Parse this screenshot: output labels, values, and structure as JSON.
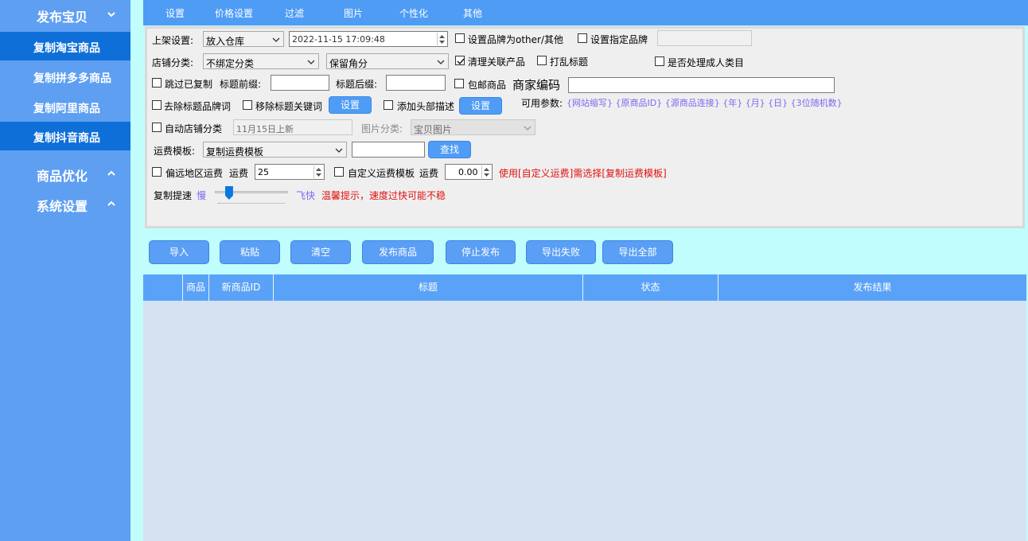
{
  "sidebar": {
    "sections": [
      {
        "label": "发布宝贝",
        "expanded": true
      },
      {
        "label": "商品优化",
        "expanded": false
      },
      {
        "label": "系统设置",
        "expanded": false
      }
    ],
    "items": [
      {
        "label": "复制淘宝商品"
      },
      {
        "label": "复制拼多多商品"
      },
      {
        "label": "复制阿里商品"
      },
      {
        "label": "复制抖音商品"
      }
    ]
  },
  "tabs": [
    "设置",
    "价格设置",
    "过滤",
    "图片",
    "个性化",
    "其他"
  ],
  "settings": {
    "shelf": {
      "label": "上架设置:",
      "option": "放入仓库",
      "datetime": "2022-11-15 17:09:48"
    },
    "brand_other": {
      "label": "设置品牌为other/其他",
      "checked": false
    },
    "brand_specific": {
      "label": "设置指定品牌",
      "checked": false,
      "value": ""
    },
    "shop_category": {
      "label": "店铺分类:",
      "option": "不绑定分类",
      "option2": "保留角分"
    },
    "clean_related": {
      "label": "清理关联产品",
      "checked": true
    },
    "shuffle_title": {
      "label": "打乱标题",
      "checked": false
    },
    "adult_category": {
      "label": "是否处理成人类目",
      "checked": false
    },
    "skip_copied": {
      "label": "跳过已复制",
      "checked": false
    },
    "title_prefix": {
      "label": "标题前缀:",
      "value": ""
    },
    "title_suffix": {
      "label": "标题后缀:",
      "value": ""
    },
    "free_shipping": {
      "label": "包邮商品",
      "checked": false
    },
    "merchant_code": {
      "label": "商家编码",
      "value": ""
    },
    "remove_brand": {
      "label": "去除标题品牌词",
      "checked": false
    },
    "remove_keywords": {
      "label": "移除标题关键词",
      "checked": false,
      "button": "设置"
    },
    "add_header": {
      "label": "添加头部描述",
      "checked": false,
      "button": "设置"
    },
    "params": {
      "label": "可用参数:",
      "value": "{网站缩写} {原商品ID} {源商品连接} {年} {月} {日} {3位随机数}"
    },
    "auto_category": {
      "label": "自动店铺分类",
      "checked": false,
      "value": "11月15日上新"
    },
    "image_category": {
      "label": "图片分类:",
      "option": "宝贝图片"
    },
    "freight": {
      "label": "运费模板:",
      "option": "复制运费模板",
      "search_value": "",
      "search_button": "查找"
    },
    "remote_freight": {
      "label": "偏远地区运费",
      "checked": false,
      "fee_label": "运费",
      "fee": "25"
    },
    "custom_freight": {
      "label": "自定义运费模板",
      "checked": false,
      "fee_label": "运费",
      "fee": "0.00",
      "note": "使用[自定义运费]需选择[复制运费模板]"
    },
    "speed": {
      "label": "复制提速",
      "slow": "慢",
      "fast": "飞快",
      "level": 0.15,
      "tip": "温馨提示，速度过快可能不稳"
    }
  },
  "actions": [
    "导入",
    "粘贴",
    "清空",
    "发布商品",
    "停止发布",
    "导出失败",
    "导出全部"
  ],
  "table": {
    "columns": [
      "",
      "商品",
      "新商品ID",
      "标题",
      "状态",
      "发布结果"
    ],
    "rows": []
  },
  "colors": {
    "sidebar": "#5e9ff2",
    "active": "#0f6fd8",
    "header": "#5aa2f7",
    "accent": "#4f9cf5",
    "warning": "#e0100e"
  }
}
